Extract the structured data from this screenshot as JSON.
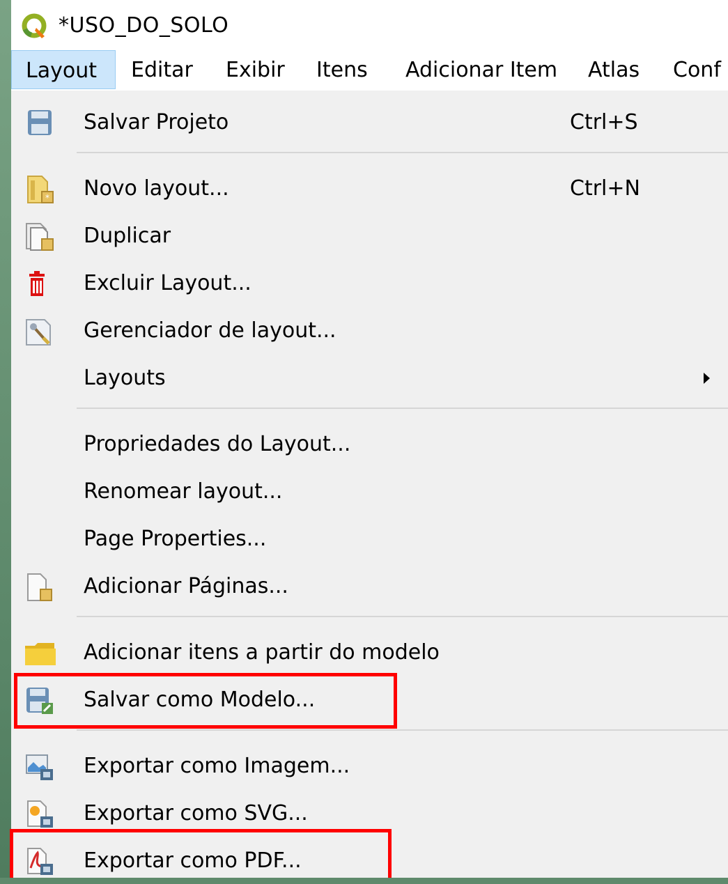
{
  "window": {
    "title": "*USO_DO_SOLO"
  },
  "menubar": {
    "items": [
      {
        "label": "Layout"
      },
      {
        "label": "Editar"
      },
      {
        "label": "Exibir"
      },
      {
        "label": "Itens"
      },
      {
        "label": "Adicionar Item"
      },
      {
        "label": "Atlas"
      },
      {
        "label": "Conf"
      }
    ],
    "active": "Layout"
  },
  "menu": {
    "items": [
      {
        "label": "Salvar Projeto",
        "shortcut": "Ctrl+S",
        "icon": "save-icon"
      },
      {
        "label": "Novo layout...",
        "shortcut": "Ctrl+N",
        "icon": "new-layout-icon"
      },
      {
        "label": "Duplicar",
        "icon": "duplicate-layout-icon"
      },
      {
        "label": "Excluir Layout...",
        "icon": "trash-icon"
      },
      {
        "label": "Gerenciador de layout...",
        "icon": "layout-manager-icon"
      },
      {
        "label": "Layouts",
        "icon": "submenu-arrow-icon"
      },
      {
        "label": "Propriedades do Layout..."
      },
      {
        "label": "Renomear layout..."
      },
      {
        "label": "Page Properties..."
      },
      {
        "label": "Adicionar Páginas...",
        "icon": "add-page-icon"
      },
      {
        "label": "Adicionar itens a partir do modelo",
        "icon": "folder-icon"
      },
      {
        "label": "Salvar como Modelo...",
        "icon": "save-as-template-icon"
      },
      {
        "label": "Exportar como Imagem...",
        "icon": "export-image-icon"
      },
      {
        "label": "Exportar como SVG...",
        "icon": "export-svg-icon"
      },
      {
        "label": "Exportar como PDF...",
        "icon": "export-pdf-icon"
      }
    ]
  },
  "annotation": {
    "color": "#ff0000"
  }
}
